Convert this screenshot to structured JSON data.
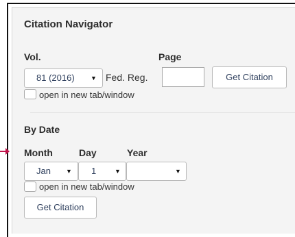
{
  "navigator": {
    "title": "Citation Navigator",
    "vol_label": "Vol.",
    "page_label": "Page",
    "volume_select": "81 (2016)",
    "fed_reg": "Fed. Reg.",
    "page_value": "",
    "get_citation_label": "Get Citation",
    "open_new_tab_label": "open in new tab/window"
  },
  "by_date": {
    "heading": "By Date",
    "month_label": "Month",
    "day_label": "Day",
    "year_label": "Year",
    "month_value": "Jan",
    "day_value": "1",
    "year_value": "",
    "open_new_tab_label": "open in new tab/window",
    "get_citation_label": "Get Citation"
  },
  "icons": {
    "dropdown": "chevron-down-icon",
    "arrow": "arrow-right-icon"
  },
  "colors": {
    "accent_arrow": "#c0134a",
    "panel_bg": "#f4f4f4"
  }
}
